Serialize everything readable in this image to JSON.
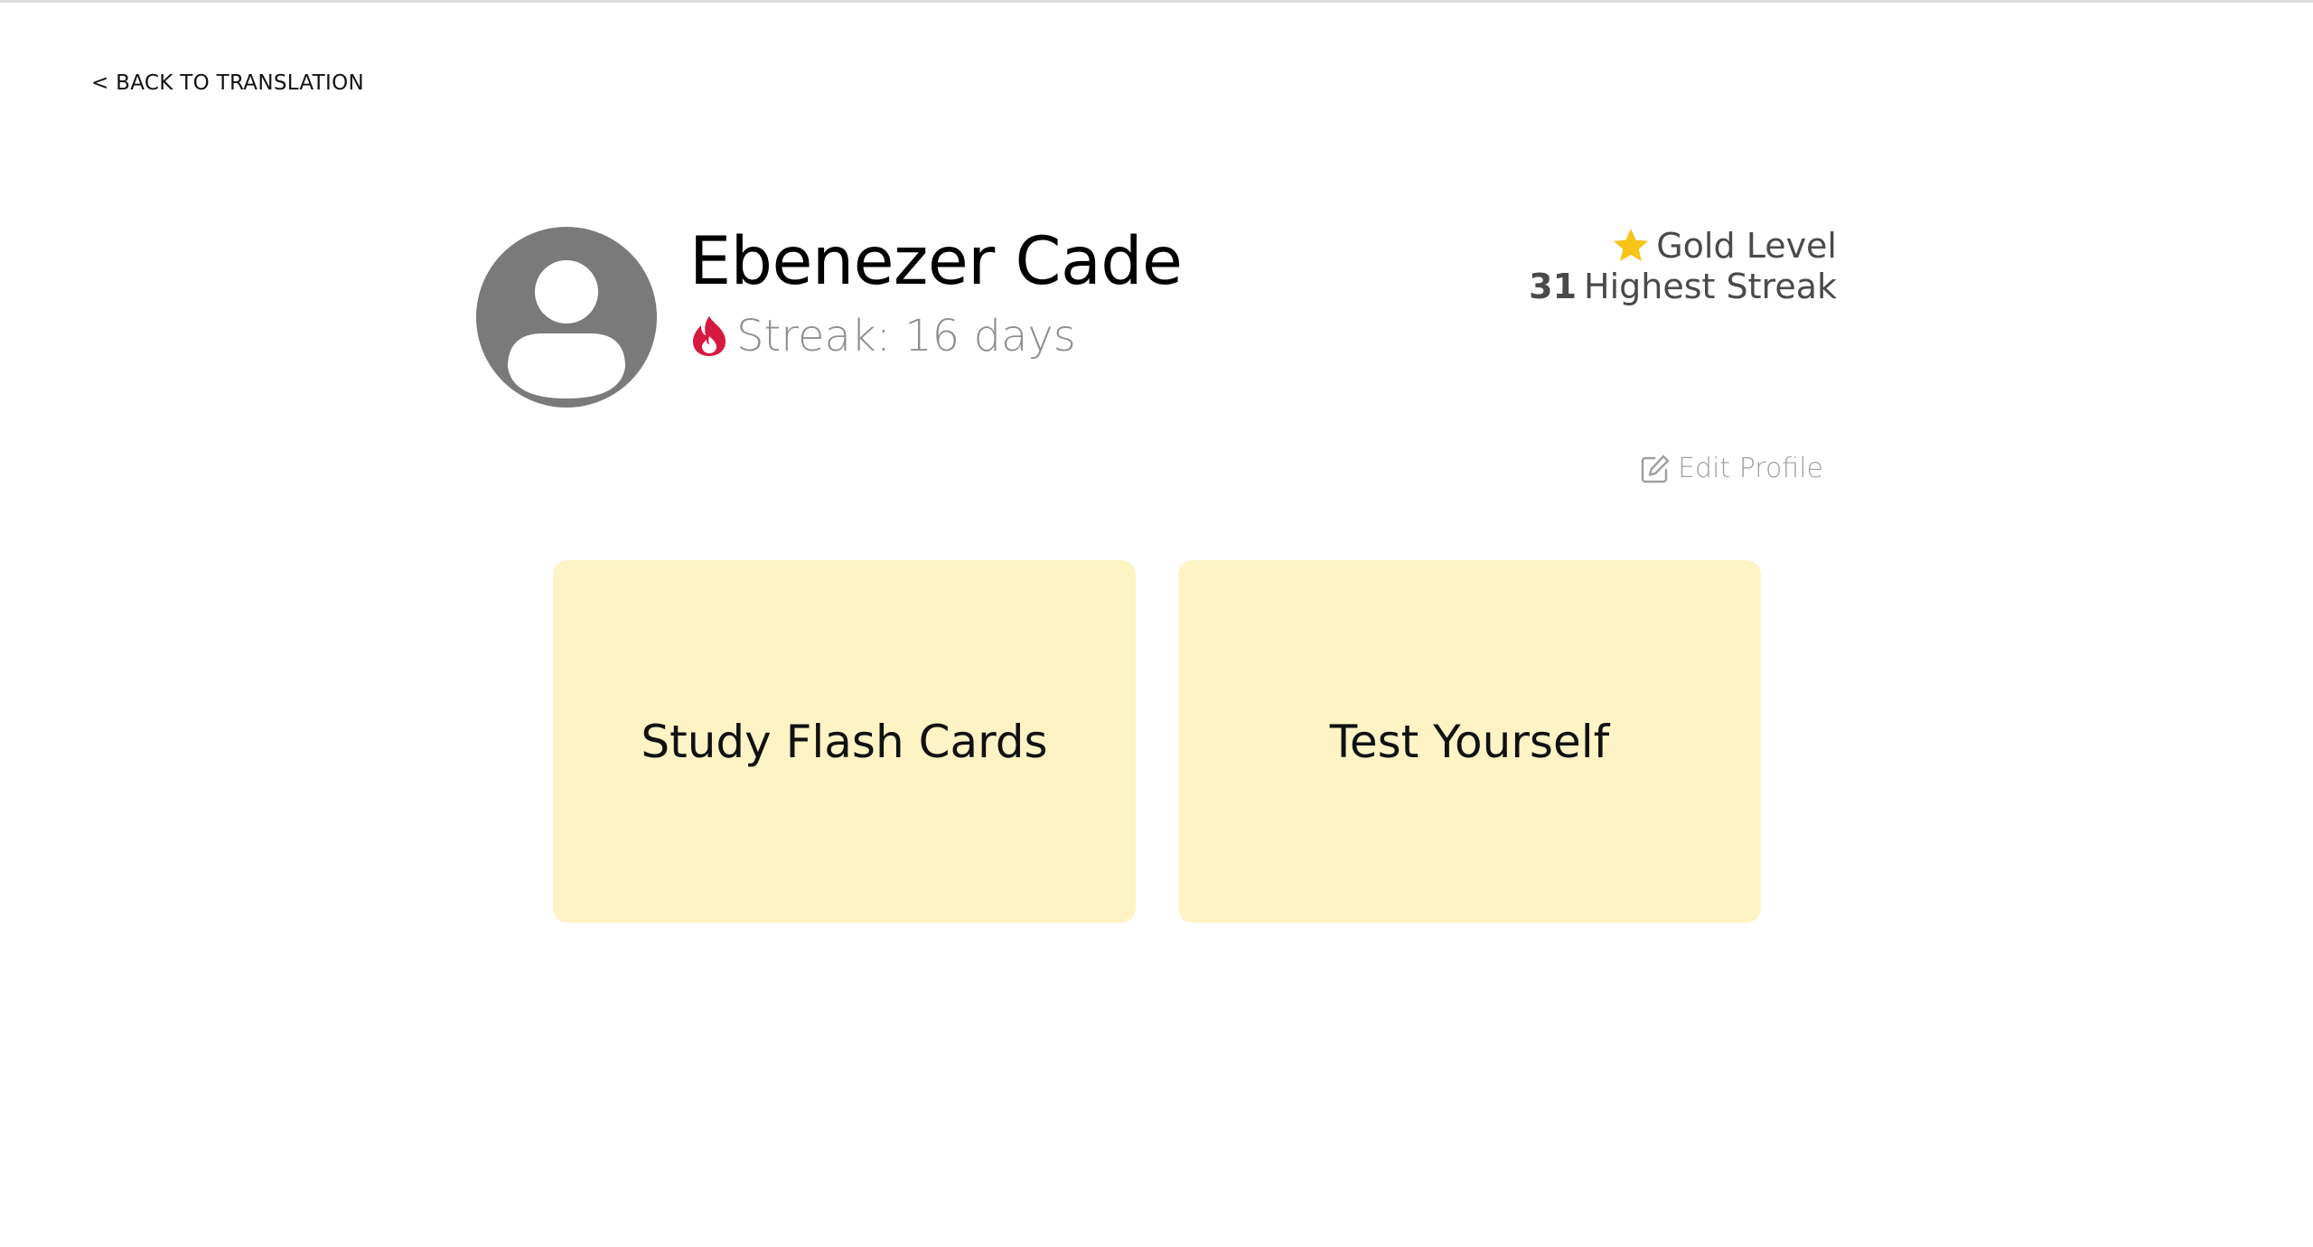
{
  "nav": {
    "back_label": "< BACK TO TRANSLATION"
  },
  "profile": {
    "name": "Ebenezer Cade",
    "streak_text": "Streak: 16 days",
    "level_text": "Gold Level",
    "highest_streak_value": "31",
    "highest_streak_label": "Highest Streak",
    "edit_label": "Edit Profile"
  },
  "cards": {
    "study_label": "Study Flash Cards",
    "test_label": "Test Yourself"
  },
  "icons": {
    "avatar": "user-avatar-icon",
    "streak": "flame-icon",
    "level": "star-icon",
    "edit": "edit-icon"
  },
  "colors": {
    "card_background": "#fef3c5",
    "flame": "#d7193f",
    "star": "#f6c417",
    "avatar": "#7a7a7a",
    "muted_text": "#8f8f8f"
  }
}
